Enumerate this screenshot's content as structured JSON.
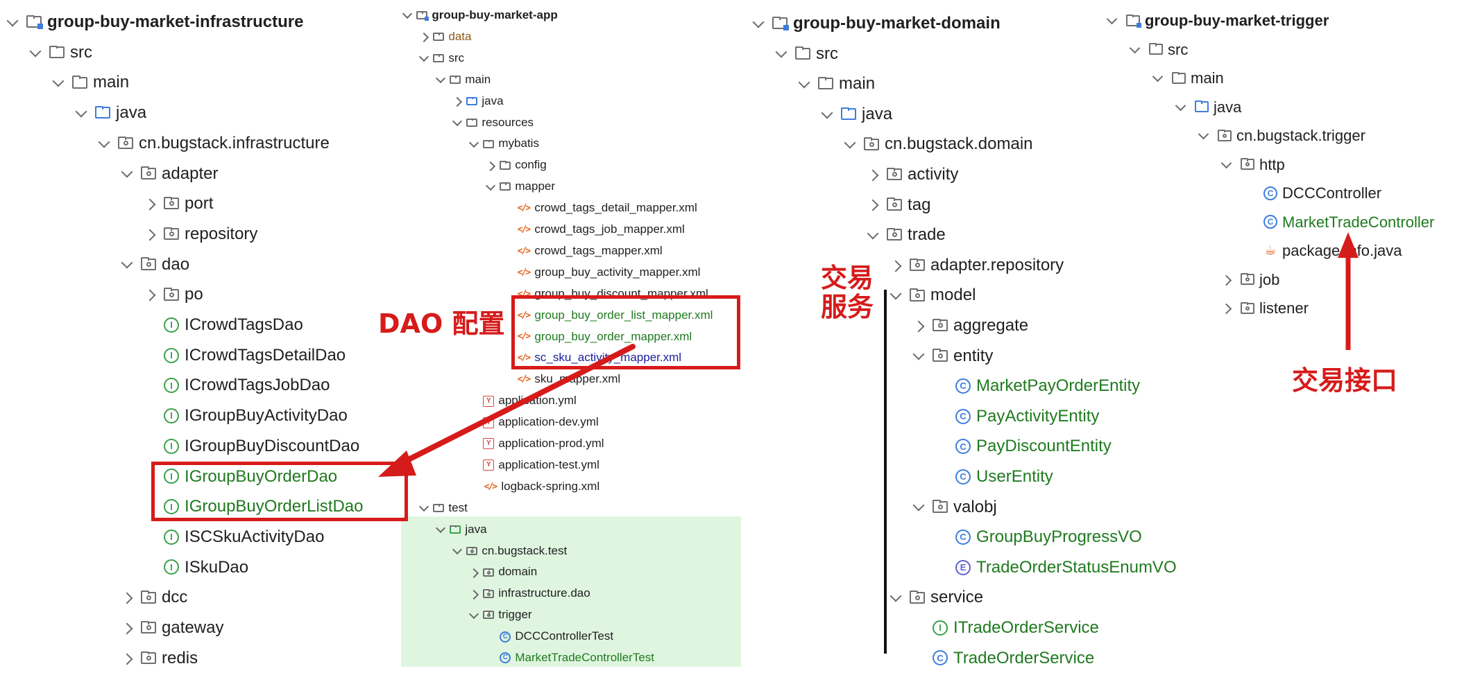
{
  "panels": {
    "infrastructure": {
      "rows": [
        {
          "label": "group-buy-market-infrastructure",
          "icon": "module",
          "chev": "down",
          "bold": true
        },
        {
          "label": "src",
          "icon": "folder",
          "chev": "down"
        },
        {
          "label": "main",
          "icon": "folder",
          "chev": "down"
        },
        {
          "label": "java",
          "icon": "folder-blue",
          "chev": "down"
        },
        {
          "label": "cn.bugstack.infrastructure",
          "icon": "package",
          "chev": "down"
        },
        {
          "label": "adapter",
          "icon": "package",
          "chev": "down"
        },
        {
          "label": "port",
          "icon": "package",
          "chev": "right"
        },
        {
          "label": "repository",
          "icon": "package",
          "chev": "right"
        },
        {
          "label": "dao",
          "icon": "package",
          "chev": "down"
        },
        {
          "label": "po",
          "icon": "package",
          "chev": "right"
        },
        {
          "label": "ICrowdTagsDao",
          "icon": "interface"
        },
        {
          "label": "ICrowdTagsDetailDao",
          "icon": "interface"
        },
        {
          "label": "ICrowdTagsJobDao",
          "icon": "interface"
        },
        {
          "label": "IGroupBuyActivityDao",
          "icon": "interface"
        },
        {
          "label": "IGroupBuyDiscountDao",
          "icon": "interface"
        },
        {
          "label": "IGroupBuyOrderDao",
          "icon": "interface",
          "color": "green"
        },
        {
          "label": "IGroupBuyOrderListDao",
          "icon": "interface",
          "color": "green"
        },
        {
          "label": "ISCSkuActivityDao",
          "icon": "interface"
        },
        {
          "label": "ISkuDao",
          "icon": "interface"
        },
        {
          "label": "dcc",
          "icon": "package",
          "chev": "right"
        },
        {
          "label": "gateway",
          "icon": "package",
          "chev": "right"
        },
        {
          "label": "redis",
          "icon": "package",
          "chev": "right"
        }
      ]
    },
    "app": {
      "rows": [
        {
          "label": "group-buy-market-app",
          "icon": "module",
          "chev": "down",
          "bold": true
        },
        {
          "label": "data",
          "icon": "folder",
          "chev": "right",
          "color": "brown"
        },
        {
          "label": "src",
          "icon": "folder",
          "chev": "down"
        },
        {
          "label": "main",
          "icon": "folder",
          "chev": "down"
        },
        {
          "label": "java",
          "icon": "folder-blue",
          "chev": "right"
        },
        {
          "label": "resources",
          "icon": "folder",
          "chev": "down"
        },
        {
          "label": "mybatis",
          "icon": "folder",
          "chev": "down"
        },
        {
          "label": "config",
          "icon": "folder",
          "chev": "right"
        },
        {
          "label": "mapper",
          "icon": "folder",
          "chev": "down"
        },
        {
          "label": "crowd_tags_detail_mapper.xml",
          "icon": "xml"
        },
        {
          "label": "crowd_tags_job_mapper.xml",
          "icon": "xml"
        },
        {
          "label": "crowd_tags_mapper.xml",
          "icon": "xml"
        },
        {
          "label": "group_buy_activity_mapper.xml",
          "icon": "xml"
        },
        {
          "label": "group_buy_discount_mapper.xml",
          "icon": "xml"
        },
        {
          "label": "group_buy_order_list_mapper.xml",
          "icon": "xml",
          "color": "green"
        },
        {
          "label": "group_buy_order_mapper.xml",
          "icon": "xml",
          "color": "green"
        },
        {
          "label": "sc_sku_activity_mapper.xml",
          "icon": "xml",
          "color": "blue"
        },
        {
          "label": "sku_mapper.xml",
          "icon": "xml"
        },
        {
          "label": "application.yml",
          "icon": "yml"
        },
        {
          "label": "application-dev.yml",
          "icon": "yml"
        },
        {
          "label": "application-prod.yml",
          "icon": "yml"
        },
        {
          "label": "application-test.yml",
          "icon": "yml"
        },
        {
          "label": "logback-spring.xml",
          "icon": "xml"
        },
        {
          "label": "test",
          "icon": "folder",
          "chev": "down"
        },
        {
          "label": "java",
          "icon": "folder-green",
          "chev": "down"
        },
        {
          "label": "cn.bugstack.test",
          "icon": "package",
          "chev": "down"
        },
        {
          "label": "domain",
          "icon": "package",
          "chev": "right"
        },
        {
          "label": "infrastructure.dao",
          "icon": "package",
          "chev": "right"
        },
        {
          "label": "trigger",
          "icon": "package",
          "chev": "down"
        },
        {
          "label": "DCCControllerTest",
          "icon": "class"
        },
        {
          "label": "MarketTradeControllerTest",
          "icon": "class",
          "color": "green"
        }
      ]
    },
    "domain": {
      "rows": [
        {
          "label": "group-buy-market-domain",
          "icon": "module",
          "chev": "down",
          "bold": true
        },
        {
          "label": "src",
          "icon": "folder",
          "chev": "down"
        },
        {
          "label": "main",
          "icon": "folder",
          "chev": "down"
        },
        {
          "label": "java",
          "icon": "folder-blue",
          "chev": "down"
        },
        {
          "label": "cn.bugstack.domain",
          "icon": "package",
          "chev": "down"
        },
        {
          "label": "activity",
          "icon": "package",
          "chev": "right"
        },
        {
          "label": "tag",
          "icon": "package",
          "chev": "right"
        },
        {
          "label": "trade",
          "icon": "package",
          "chev": "down"
        },
        {
          "label": "adapter.repository",
          "icon": "package",
          "chev": "right"
        },
        {
          "label": "model",
          "icon": "package",
          "chev": "down"
        },
        {
          "label": "aggregate",
          "icon": "package",
          "chev": "right"
        },
        {
          "label": "entity",
          "icon": "package",
          "chev": "down"
        },
        {
          "label": "MarketPayOrderEntity",
          "icon": "class",
          "color": "green"
        },
        {
          "label": "PayActivityEntity",
          "icon": "class",
          "color": "green"
        },
        {
          "label": "PayDiscountEntity",
          "icon": "class",
          "color": "green"
        },
        {
          "label": "UserEntity",
          "icon": "class",
          "color": "green"
        },
        {
          "label": "valobj",
          "icon": "package",
          "chev": "down"
        },
        {
          "label": "GroupBuyProgressVO",
          "icon": "class",
          "color": "green"
        },
        {
          "label": "TradeOrderStatusEnumVO",
          "icon": "enum",
          "color": "green"
        },
        {
          "label": "service",
          "icon": "package",
          "chev": "down"
        },
        {
          "label": "ITradeOrderService",
          "icon": "interface",
          "color": "green"
        },
        {
          "label": "TradeOrderService",
          "icon": "class",
          "color": "green"
        }
      ]
    },
    "trigger": {
      "rows": [
        {
          "label": "group-buy-market-trigger",
          "icon": "module",
          "chev": "down",
          "bold": true
        },
        {
          "label": "src",
          "icon": "folder",
          "chev": "down"
        },
        {
          "label": "main",
          "icon": "folder",
          "chev": "down"
        },
        {
          "label": "java",
          "icon": "folder-blue",
          "chev": "down"
        },
        {
          "label": "cn.bugstack.trigger",
          "icon": "package",
          "chev": "down"
        },
        {
          "label": "http",
          "icon": "package",
          "chev": "down"
        },
        {
          "label": "DCCController",
          "icon": "class"
        },
        {
          "label": "MarketTradeController",
          "icon": "class",
          "color": "green"
        },
        {
          "label": "package-info.java",
          "icon": "java"
        },
        {
          "label": "job",
          "icon": "package",
          "chev": "right"
        },
        {
          "label": "listener",
          "icon": "package",
          "chev": "right"
        }
      ]
    }
  },
  "annotations": {
    "dao_config": "DAO 配置",
    "trade_service_line1": "交易",
    "trade_service_line2": "服务",
    "trade_interface": "交易接口"
  },
  "colors": {
    "accent_red": "#d61b1b",
    "label_green": "#1f7a1f",
    "test_bg": "#dff5e0"
  }
}
